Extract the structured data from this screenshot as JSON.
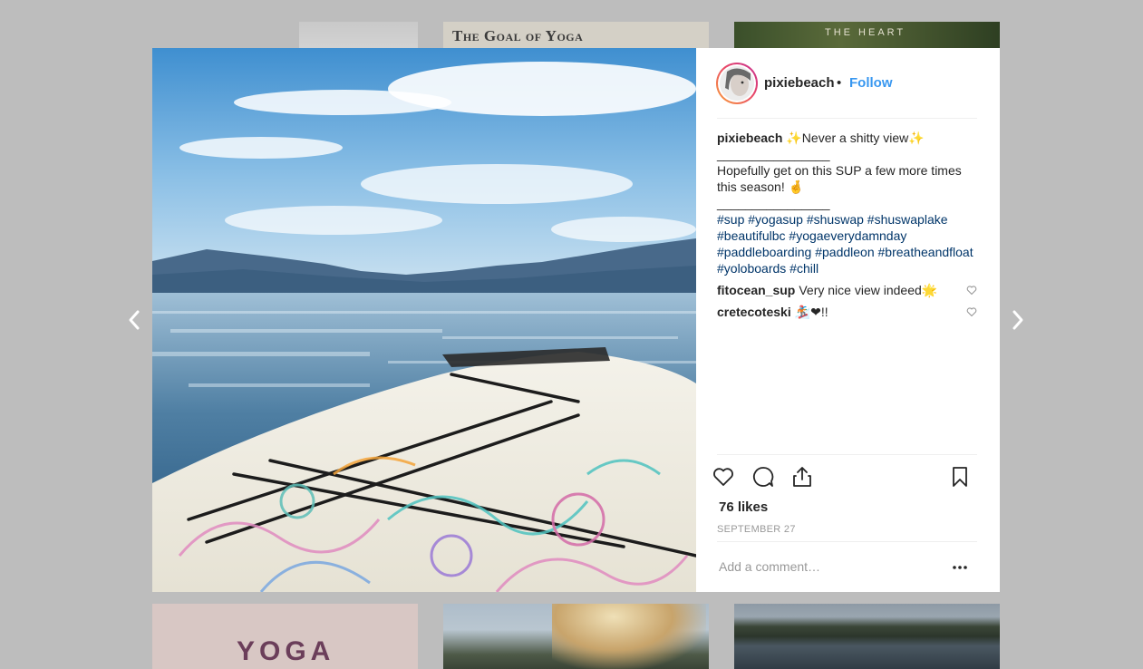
{
  "background_tiles": {
    "top_center_title": "The Goal of Yoga",
    "top_right_title": "THE HEART",
    "bottom_left_title": "YOGA"
  },
  "nav": {
    "prev_icon": "chevron-left-icon",
    "next_icon": "chevron-right-icon"
  },
  "post": {
    "author": "pixiebeach",
    "dot": "•",
    "follow_label": "Follow",
    "caption": {
      "author": "pixiebeach",
      "line1": "✨Never a shitty view✨",
      "separator1": "________________",
      "line2": "Hopefully get on this SUP a few more times this season! 🤞",
      "separator2": "________________",
      "hashtags": [
        "#sup",
        "#yogasup",
        "#shuswap",
        "#shuswaplake",
        "#beautifulbc",
        "#yogaeverydamnday",
        "#paddleboarding",
        "#paddleon",
        "#breatheandfloat",
        "#yoloboards",
        "#chill"
      ]
    },
    "comments": [
      {
        "user": "fitocean_sup",
        "text": "Very nice view indeed🌟"
      },
      {
        "user": "cretecoteski",
        "text": "🏂❤!!"
      }
    ],
    "likes": "76 likes",
    "date": "SEPTEMBER 27",
    "add_comment_placeholder": "Add a comment…",
    "icons": {
      "like": "heart-icon",
      "comment": "comment-bubble-icon",
      "share": "share-icon",
      "save": "bookmark-icon",
      "more": "more-options-icon"
    }
  },
  "colors": {
    "link": "#3897f0",
    "hashtag": "#003569",
    "text": "#262626",
    "muted": "#999999"
  }
}
